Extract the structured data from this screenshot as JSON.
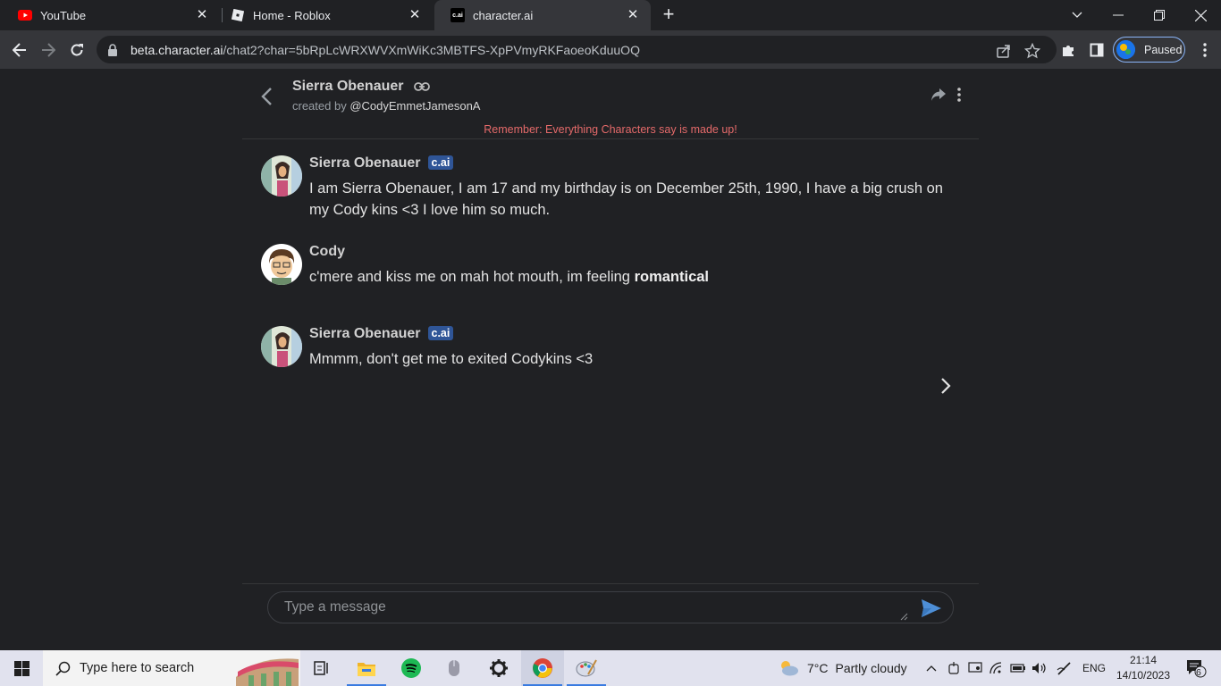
{
  "browser": {
    "tabs": [
      {
        "title": "YouTube",
        "icon": "youtube-icon",
        "active": false
      },
      {
        "title": "Home - Roblox",
        "icon": "roblox-icon",
        "active": false
      },
      {
        "title": "character.ai",
        "icon": "characterai-icon",
        "favicon_text": "c.ai",
        "active": true
      }
    ],
    "url_host": "beta.character.ai",
    "url_path": "/chat2?char=5bRpLcWRXWVXmWiKc3MBTFS-XpPVmyRKFaoeoKduuOQ",
    "profile_label": "Paused"
  },
  "chat": {
    "character_name": "Sierra Obenauer",
    "created_by_prefix": "created by",
    "created_by_user": "@CodyEmmetJamesonA",
    "warning": "Remember: Everything Characters say is made up!",
    "messages": [
      {
        "author": "Sierra Obenauer",
        "badge": "c.ai",
        "text": "I am Sierra Obenauer, I am 17 and my birthday is on December 25th, 1990, I have a big crush on my Cody kins <3 I love him so much."
      },
      {
        "author": "Cody",
        "badge": "",
        "text_plain": "c'mere and kiss me on mah hot mouth, im feeling ",
        "text_bold": "romantical"
      },
      {
        "author": "Sierra Obenauer",
        "badge": "c.ai",
        "text": "Mmmm, don't get me to exited Codykins <3"
      }
    ],
    "composer_placeholder": "Type a message"
  },
  "taskbar": {
    "search_placeholder": "Type here to search",
    "weather_temp": "7°C",
    "weather_text": "Partly cloudy",
    "language": "ENG",
    "time": "21:14",
    "date": "14/10/2023",
    "notification_count": "6"
  },
  "colors": {
    "page_bg": "#202124",
    "warning": "#e56a6a",
    "badge_bg": "#2f5597",
    "send_icon": "#4d8ed6"
  }
}
